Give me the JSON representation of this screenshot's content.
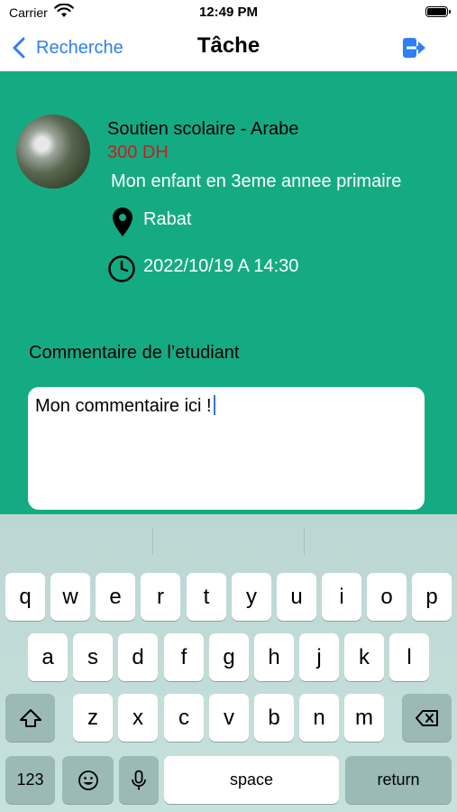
{
  "status_bar": {
    "carrier": "Carrier",
    "time": "12:49 PM"
  },
  "nav": {
    "back_label": "Recherche",
    "title": "Tâche",
    "logout_icon": "logout-icon"
  },
  "task": {
    "course": "Soutien scolaire - Arabe",
    "price": "300 DH",
    "description": "Mon enfant en 3eme annee primaire",
    "location": "Rabat",
    "datetime": "2022/10/19 A 14:30"
  },
  "comment": {
    "label": "Commentaire de l’etudiant",
    "value": "Mon commentaire ici !"
  },
  "keyboard": {
    "row1": [
      "q",
      "w",
      "e",
      "r",
      "t",
      "y",
      "u",
      "i",
      "o",
      "p"
    ],
    "row2": [
      "a",
      "s",
      "d",
      "f",
      "g",
      "h",
      "j",
      "k",
      "l"
    ],
    "row3": [
      "z",
      "x",
      "c",
      "v",
      "b",
      "n",
      "m"
    ],
    "numbers_label": "123",
    "space_label": "space",
    "return_label": "return"
  },
  "colors": {
    "accent": "#2f7ff0",
    "background": "#15ab82",
    "price": "#d41818"
  }
}
